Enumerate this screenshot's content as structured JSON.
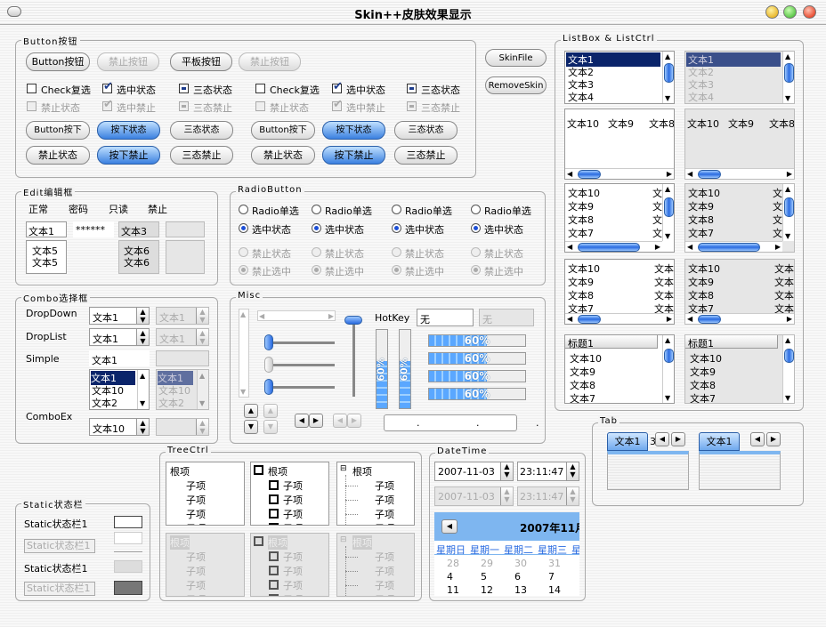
{
  "window": {
    "title": "Skin++皮肤效果显示"
  },
  "button_group": {
    "title": "Button按钮",
    "row1": [
      "Button按钮",
      "禁止按钮",
      "平板按钮",
      "禁止按钮"
    ],
    "check_row1": [
      "Check复选",
      "选中状态",
      "三态状态",
      "Check复选",
      "选中状态",
      "三态状态"
    ],
    "check_row2": [
      "禁止状态",
      "选中禁止",
      "三态禁止",
      "禁止状态",
      "选中禁止",
      "三态禁止"
    ],
    "btn_row3": [
      "Button按下",
      "按下状态",
      "三态状态",
      "Button按下",
      "按下状态",
      "三态状态"
    ],
    "btn_row4": [
      "禁止状态",
      "按下禁止",
      "三态禁止",
      "禁止状态",
      "按下禁止",
      "三态禁止"
    ]
  },
  "side_buttons": {
    "skinfile": "SkinFile",
    "removeskin": "RemoveSkin"
  },
  "edit_group": {
    "title": "Edit编辑框",
    "headers": [
      "正常",
      "密码",
      "只读",
      "禁止"
    ],
    "row1": [
      "文本1",
      "******",
      "文本3"
    ],
    "multi": [
      [
        "文本5",
        "文本5"
      ],
      [
        "文本6",
        "文本6"
      ]
    ]
  },
  "radio_group": {
    "title": "RadioButton",
    "row1": [
      "Radio单选",
      "Radio单选",
      "Radio单选",
      "Radio单选"
    ],
    "row2": [
      "选中状态",
      "选中状态",
      "选中状态",
      "选中状态"
    ],
    "row3": [
      "禁止状态",
      "禁止状态",
      "禁止状态",
      "禁止状态"
    ],
    "row4": [
      "禁止选中",
      "禁止选中",
      "禁止选中",
      "禁止选中"
    ]
  },
  "combo_group": {
    "title": "Combo选择框",
    "labels": [
      "DropDown",
      "DropList",
      "Simple",
      "ComboEx"
    ],
    "dropdown": "文本1",
    "dropdown_dis": "文本1",
    "droplist": "文本1",
    "droplist_dis": "文本1",
    "simple": "文本1",
    "simple_list": [
      "文本1",
      "文本10",
      "文本2"
    ],
    "simple_list_dis": [
      "文本1",
      "文本10",
      "文本2"
    ],
    "comboex": "文本10"
  },
  "misc_group": {
    "title": "Misc",
    "hotkey_label": "HotKey",
    "hotkey_value": "无",
    "progress_text": "60%",
    "progress_value": 0.6,
    "vprogress_text": "60%",
    "ip_dots": ". . ."
  },
  "static_group": {
    "title": "Static状态栏",
    "items": [
      "Static状态栏1",
      "Static状态栏1",
      "Static状态栏1",
      "Static状态栏1"
    ]
  },
  "tree_group": {
    "title": "TreeCtrl",
    "root": "根项",
    "child": "子项"
  },
  "date_group": {
    "title": "DateTime",
    "date": "2007-11-03",
    "time": "23:11:47",
    "cal_title": "2007年11月",
    "weekdays": [
      "星期日",
      "星期一",
      "星期二",
      "星期三",
      "星"
    ],
    "rows": [
      [
        "28",
        "29",
        "30",
        "31"
      ],
      [
        "4",
        "5",
        "6",
        "7"
      ],
      [
        "11",
        "12",
        "13",
        "14"
      ]
    ]
  },
  "list_group": {
    "title": "ListBox & ListCtrl",
    "listbox": [
      "文本1",
      "文本2",
      "文本3",
      "文本4"
    ],
    "horiz": [
      "文本10",
      "文本9",
      "文本8"
    ],
    "report": [
      "文本10",
      "文本9",
      "文本8",
      "文本7"
    ],
    "report_col2": "文本",
    "header": "标题1"
  },
  "tab_group": {
    "title": "Tab",
    "tab": "文本1",
    "tab2": "3"
  },
  "colors": {
    "accent": "#2a6be0",
    "selected": "#0a246a"
  }
}
